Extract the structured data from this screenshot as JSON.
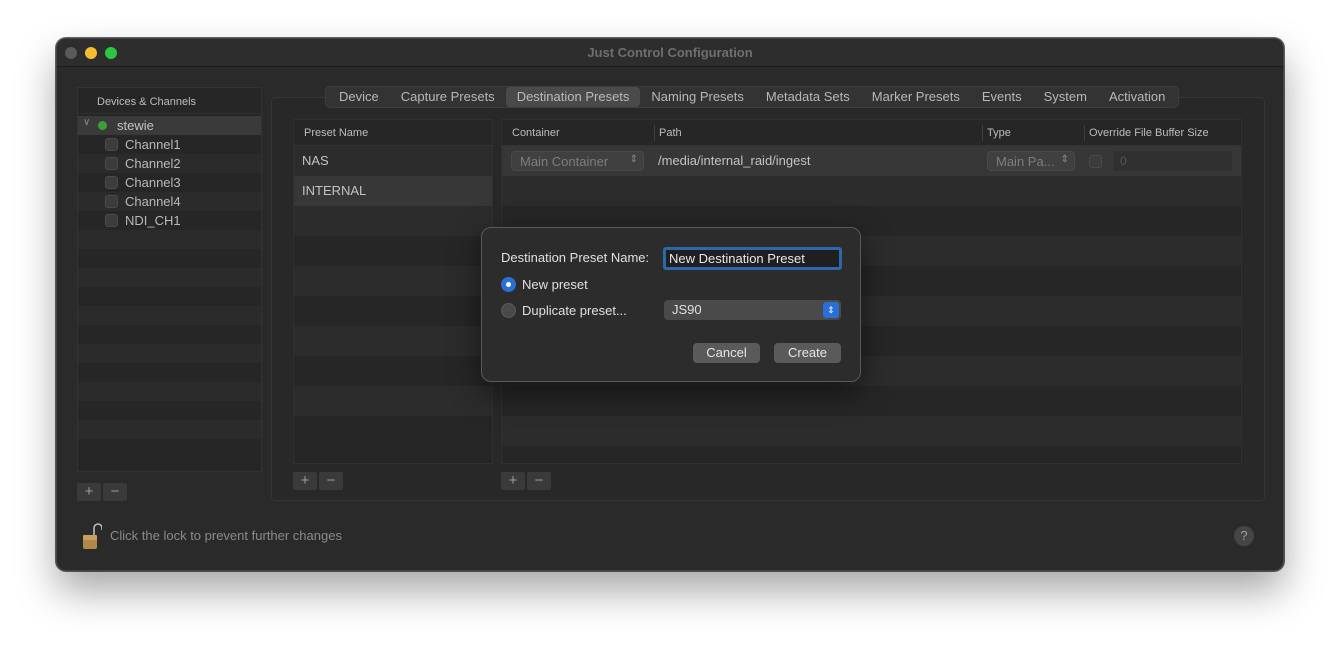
{
  "window": {
    "title": "Just Control Configuration"
  },
  "sidebar": {
    "header": "Devices & Channels",
    "device": "stewie",
    "channels": [
      "Channel1",
      "Channel2",
      "Channel3",
      "Channel4",
      "NDI_CH1"
    ]
  },
  "tabs": [
    "Device",
    "Capture Presets",
    "Destination Presets",
    "Naming Presets",
    "Metadata Sets",
    "Marker Presets",
    "Events",
    "System",
    "Activation"
  ],
  "presets": {
    "header": "Preset Name",
    "items": [
      "NAS",
      "INTERNAL"
    ]
  },
  "destinations": {
    "headers": {
      "container": "Container",
      "path": "Path",
      "type": "Type",
      "override": "Override File Buffer Size"
    },
    "row": {
      "container": "Main Container",
      "path": "/media/internal_raid/ingest",
      "type": "Main Pa...",
      "override_value": "0"
    }
  },
  "controls": {
    "add": "+",
    "remove": "−",
    "help": "?"
  },
  "lock": {
    "text": "Click the lock to prevent further changes"
  },
  "dialog": {
    "label": "Destination Preset Name:",
    "input_value": "New Destination Preset",
    "radio_new": "New preset",
    "radio_duplicate": "Duplicate preset...",
    "duplicate_selected": "JS90",
    "cancel": "Cancel",
    "create": "Create"
  },
  "colors": {
    "accent": "#2a6fd6",
    "focus_ring": "#2c69ac"
  }
}
